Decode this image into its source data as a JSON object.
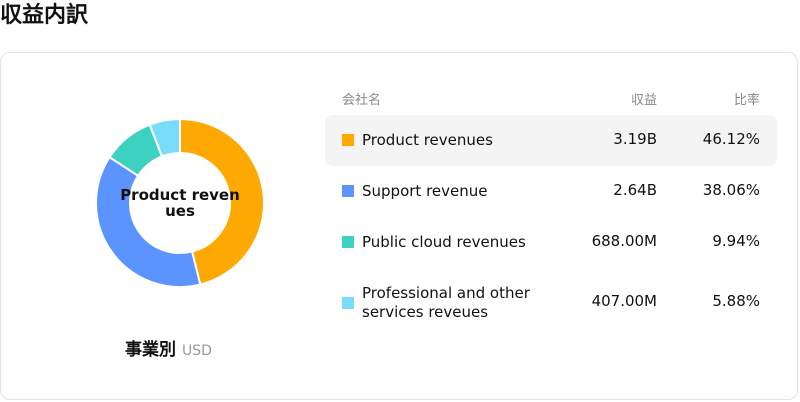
{
  "page": {
    "title": "収益内訳"
  },
  "chart": {
    "center_label": "Product revenues",
    "caption": "事業別",
    "unit": "USD"
  },
  "table": {
    "headers": {
      "name": "会社名",
      "revenue": "収益",
      "ratio": "比率"
    }
  },
  "chart_data": {
    "type": "pie",
    "donut": true,
    "categories": [
      "Product revenues",
      "Support revenue",
      "Public cloud revenues",
      "Professional and other services reveues"
    ],
    "values_display": [
      "3.19B",
      "2.64B",
      "688.00M",
      "407.00M"
    ],
    "ratios_display": [
      "46.12%",
      "38.06%",
      "9.94%",
      "5.88%"
    ],
    "values": [
      46.12,
      38.06,
      9.94,
      5.88
    ],
    "colors": [
      "#fea802",
      "#5b93ff",
      "#3cd1c1",
      "#79dcfb"
    ],
    "highlighted_index": 0
  }
}
